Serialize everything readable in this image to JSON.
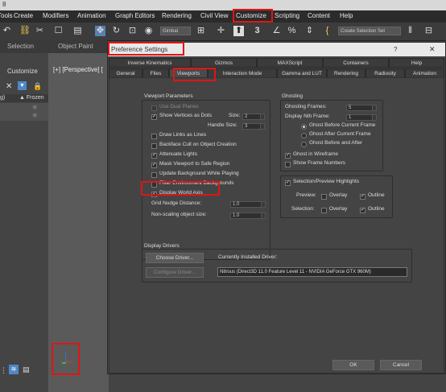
{
  "window": {
    "title_fragment": "8"
  },
  "menu": [
    "Tools",
    "Create",
    "Modifiers",
    "Animation",
    "Graph Editors",
    "Rendering",
    "Civil View",
    "Customize",
    "Scripting",
    "Content",
    "Help"
  ],
  "toolbar": {
    "gimbal": "Gimbal",
    "selection_set": "Create Selection Set"
  },
  "ribbon": {
    "tab_selection": "Selection",
    "tab_object_paint": "Object Paint"
  },
  "left_panel": {
    "customize": "Customize",
    "frozen": "Frozen",
    "g_frag": "g)"
  },
  "viewport": {
    "label": "[+] [Perspective] ["
  },
  "dialog": {
    "title": "Preference Settings",
    "help_btn": "?",
    "tabs_row1": [
      "Inverse Kinematics",
      "Gizmos",
      "MAXScript",
      "Containers",
      "Help"
    ],
    "tabs_row2": [
      "General",
      "Files",
      "Viewports",
      "Interaction Mode",
      "Gamma and LUT",
      "Rendering",
      "Radiosity",
      "Animation"
    ],
    "active_tab": "Viewports",
    "viewport_params": {
      "title": "Viewport Parameters",
      "use_dual_planes": "Use Dual Planes",
      "show_vertices_dots": "Show Vertices as Dots",
      "size_label": "Size:",
      "size_value": "2",
      "handle_size_label": "Handle Size:",
      "handle_size_value": "3",
      "draw_links": "Draw Links as Lines",
      "backface_cull": "Backface Cull on Object Creation",
      "attenuate_lights": "Attenuate Lights",
      "mask_viewport": "Mask Viewport to Safe Region",
      "update_bg": "Update Background While Playing",
      "filter_env": "Filter Environment Backgrounds",
      "display_world_axis": "Display World Axis",
      "grid_nudge_label": "Grid Nudge Distance:",
      "grid_nudge_value": "1.0",
      "non_scaling_label": "Non-scaling object size:",
      "non_scaling_value": "1.0"
    },
    "ghosting": {
      "title": "Ghosting",
      "frames_label": "Ghosting Frames:",
      "frames_value": "5",
      "nth_label": "Display Nth Frame:",
      "nth_value": "1",
      "before": "Ghost Before Current Frame",
      "after": "Ghost After Current Frame",
      "before_after": "Ghost Before and After",
      "in_wireframe": "Ghost in Wireframe",
      "frame_numbers": "Show Frame Numbers"
    },
    "highlights": {
      "title": "Selection/Preview Highlights",
      "preview_label": "Preview:",
      "selection_label": "Selection:",
      "overlay": "Overlay",
      "outline": "Outline"
    },
    "display_drivers": {
      "title": "Display Drivers",
      "choose_btn": "Choose Driver...",
      "configure_btn": "Configure Driver...",
      "current_label": "Currently Installed Driver:",
      "current_value": "Nitrous (Direct3D 11.0 Feature Level 11 - NVIDIA GeForce GTX 960M)"
    },
    "ok": "OK",
    "cancel": "Cancel"
  },
  "colors": {
    "highlight": "#e01515",
    "dialog_bg": "#444444",
    "menubar": "#2b2b2b"
  }
}
